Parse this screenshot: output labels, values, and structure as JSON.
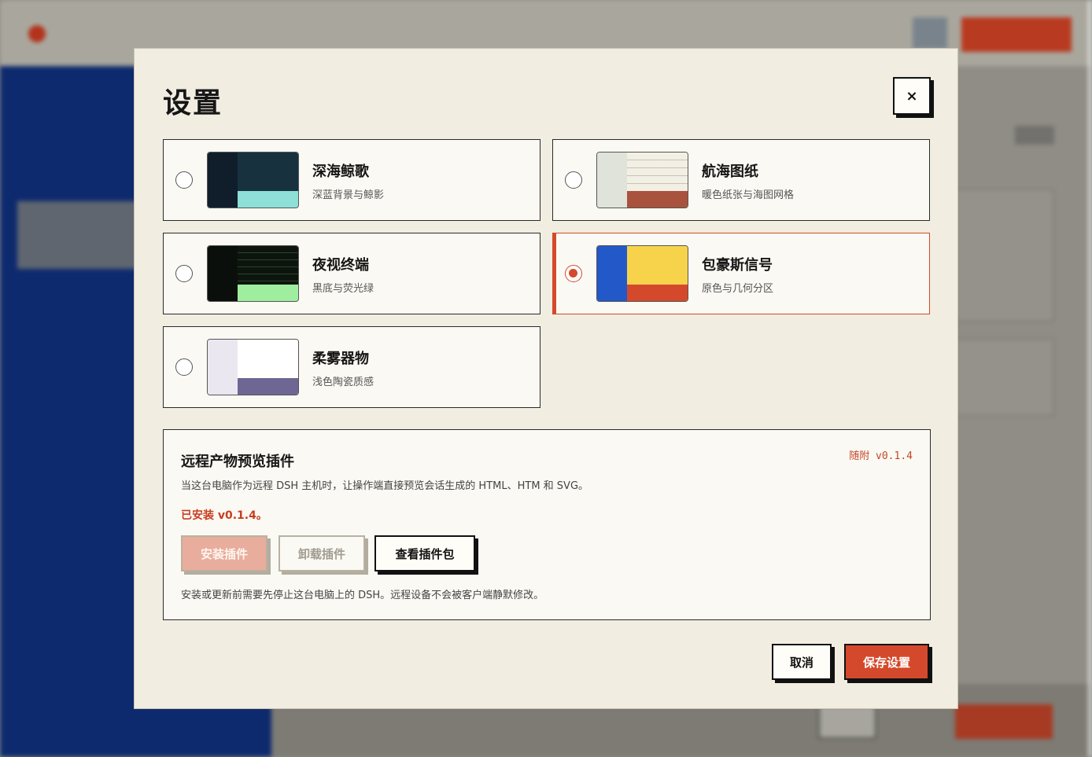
{
  "modal": {
    "title": "设置",
    "close_label": "×"
  },
  "themes": [
    {
      "name": "深海鲸歌",
      "desc": "深蓝背景与鲸影",
      "selected": false,
      "colors": {
        "left": "#101e2b",
        "right": "#17313f",
        "bar": "#8ddfd7"
      }
    },
    {
      "name": "航海图纸",
      "desc": "暖色纸张与海图网格",
      "selected": false,
      "colors": {
        "left": "#dfe3da",
        "right": "#f2efe5",
        "bar": "#a9523d"
      }
    },
    {
      "name": "夜视终端",
      "desc": "黑底与荧光绿",
      "selected": false,
      "colors": {
        "left": "#0b0f0b",
        "right": "#0d140d",
        "bar": "#9fee9f"
      }
    },
    {
      "name": "包豪斯信号",
      "desc": "原色与几何分区",
      "selected": true,
      "colors": {
        "left": "#2358c9",
        "right": "#f7d34c",
        "bar": "#d4492b"
      }
    },
    {
      "name": "柔雾器物",
      "desc": "浅色陶瓷质感",
      "selected": false,
      "colors": {
        "left": "#ebe7f1",
        "right": "#ffffff",
        "bar": "#6e6693"
      }
    }
  ],
  "plugin": {
    "title": "远程产物预览插件",
    "version": "随附 v0.1.4",
    "desc": "当这台电脑作为远程 DSH 主机时，让操作端直接预览会话生成的 HTML、HTM 和 SVG。",
    "status": "已安装 v0.1.4。",
    "install_label": "安装插件",
    "uninstall_label": "卸载插件",
    "view_label": "查看插件包",
    "note": "安装或更新前需要先停止这台电脑上的 DSH。远程设备不会被客户端静默修改。"
  },
  "footer": {
    "cancel_label": "取消",
    "save_label": "保存设置"
  }
}
